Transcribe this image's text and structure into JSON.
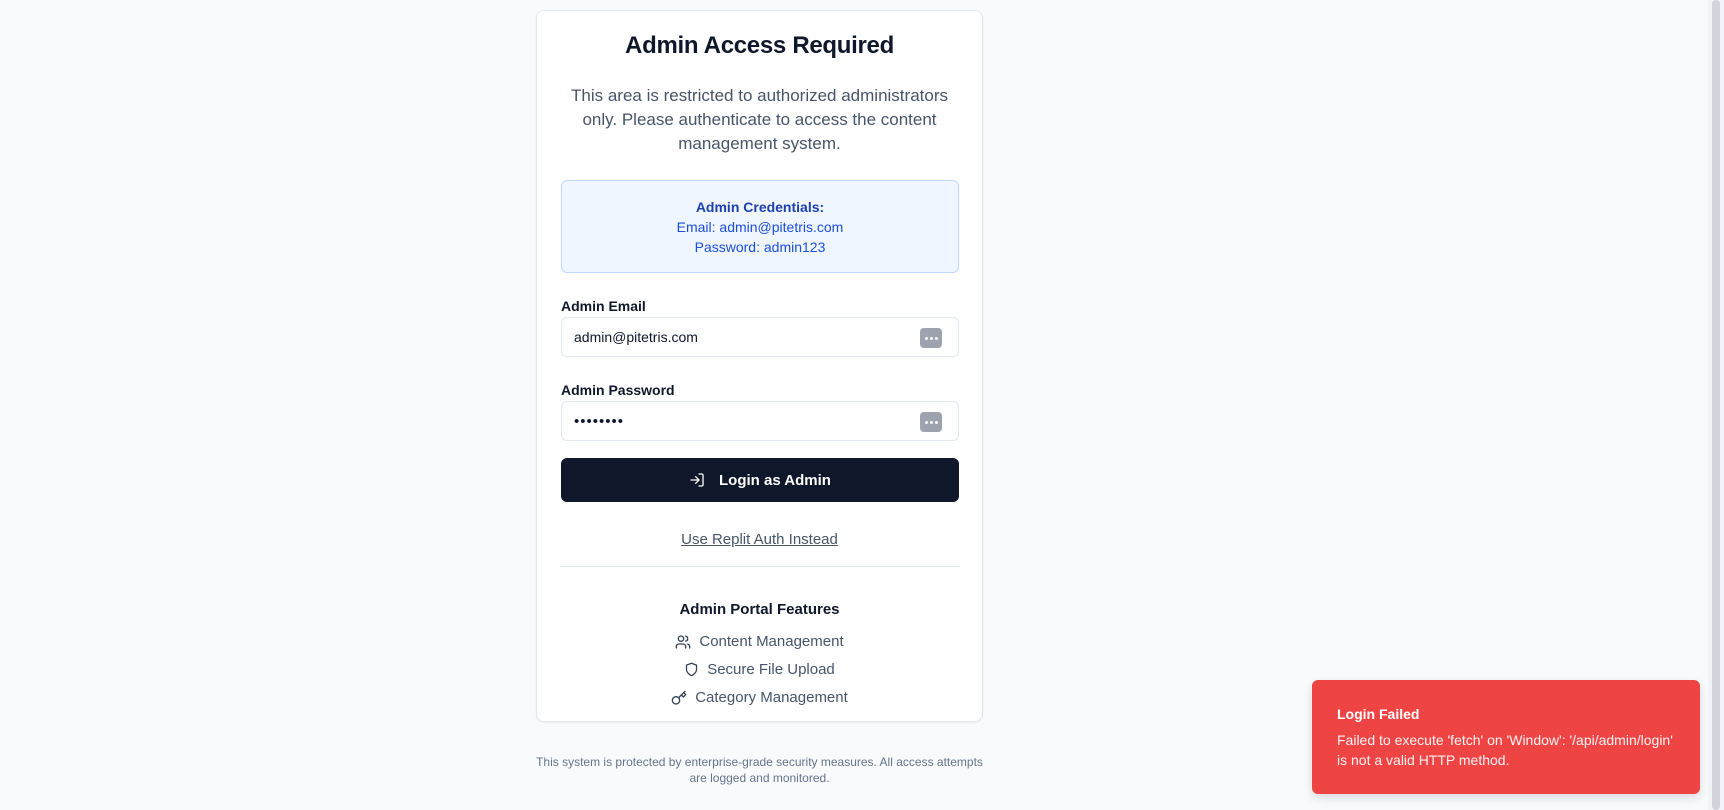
{
  "login": {
    "title": "Admin Access Required",
    "description": "This area is restricted to authorized administrators only. Please authenticate to access the content management system.",
    "credentials_box": {
      "title": "Admin Credentials:",
      "email_line": "Email: admin@pitetris.com",
      "password_line": "Password: admin123"
    },
    "email": {
      "label": "Admin Email",
      "value": "admin@pitetris.com",
      "icon": "password-manager-icon"
    },
    "password": {
      "label": "Admin Password",
      "masked_value": "••••••••",
      "icon": "password-manager-icon"
    },
    "submit_label": "Login as Admin",
    "submit_icon": "log-in-icon",
    "alt_auth_link": "Use Replit Auth Instead",
    "features": {
      "title": "Admin Portal Features",
      "items": [
        {
          "label": "Content Management",
          "icon": "users-icon"
        },
        {
          "label": "Secure File Upload",
          "icon": "shield-icon"
        },
        {
          "label": "Category Management",
          "icon": "key-icon"
        }
      ]
    }
  },
  "footer": {
    "text": "This system is protected by enterprise-grade security measures. All access attempts are logged and monitored."
  },
  "toast": {
    "title": "Login Failed",
    "message": "Failed to execute 'fetch' on 'Window': '/api/admin/login' is not a valid HTTP method.",
    "color": "#ef4444"
  },
  "colors": {
    "background": "#f8fafc",
    "primary_button": "#0f172a",
    "info_box": "#eff6ff",
    "info_text": "#1d4ed8"
  }
}
